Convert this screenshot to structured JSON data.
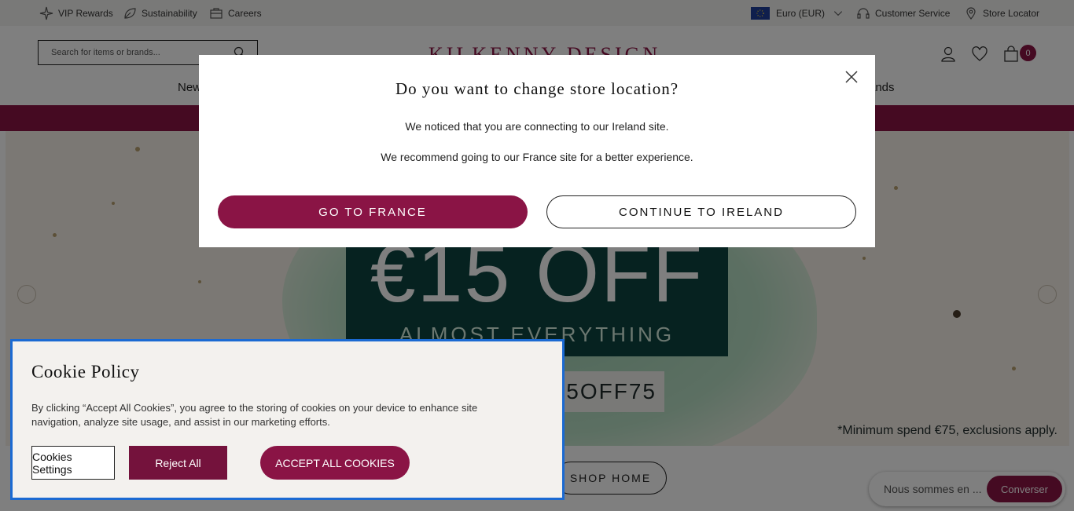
{
  "topbar": {
    "vip_label": "VIP Rewards",
    "sustainability_label": "Sustainability",
    "careers_label": "Careers",
    "currency_label": "Euro (EUR)",
    "customer_service_label": "Customer Service",
    "store_locator_label": "Store Locator"
  },
  "header": {
    "search_placeholder": "Search for items or brands...",
    "logo_text": "KILKENNY DESIGN",
    "cart_count": "0",
    "nav_left": "New",
    "nav_right": "ands"
  },
  "hero": {
    "offer": "€15 OFF",
    "subline": "ALMOST EVERYTHING",
    "code": "15OFF75",
    "note": "*Minimum spend €75, exclusions apply.",
    "cta": "SHOP HOME"
  },
  "chat": {
    "text": "Nous sommes en ...",
    "button": "Converser"
  },
  "modal": {
    "title": "Do you want to change store location?",
    "line1": "We noticed that you are connecting to our Ireland site.",
    "line2": "We recommend going to our France site for a better experience.",
    "primary_button": "GO TO FRANCE",
    "secondary_button": "CONTINUE TO IRELAND"
  },
  "cookie": {
    "title": "Cookie Policy",
    "body": "By clicking “Accept All Cookies”, you agree to the storing of cookies on your device to enhance site navigation, analyze site usage, and assist in our marketing efforts.",
    "settings_button": "Cookies Settings",
    "reject_button": "Reject All",
    "accept_button": "ACCEPT ALL COOKIES"
  },
  "colors": {
    "brand": "#8a1445",
    "cookie_focus": "#1b6ad2",
    "hero_green": "#0d4440"
  }
}
